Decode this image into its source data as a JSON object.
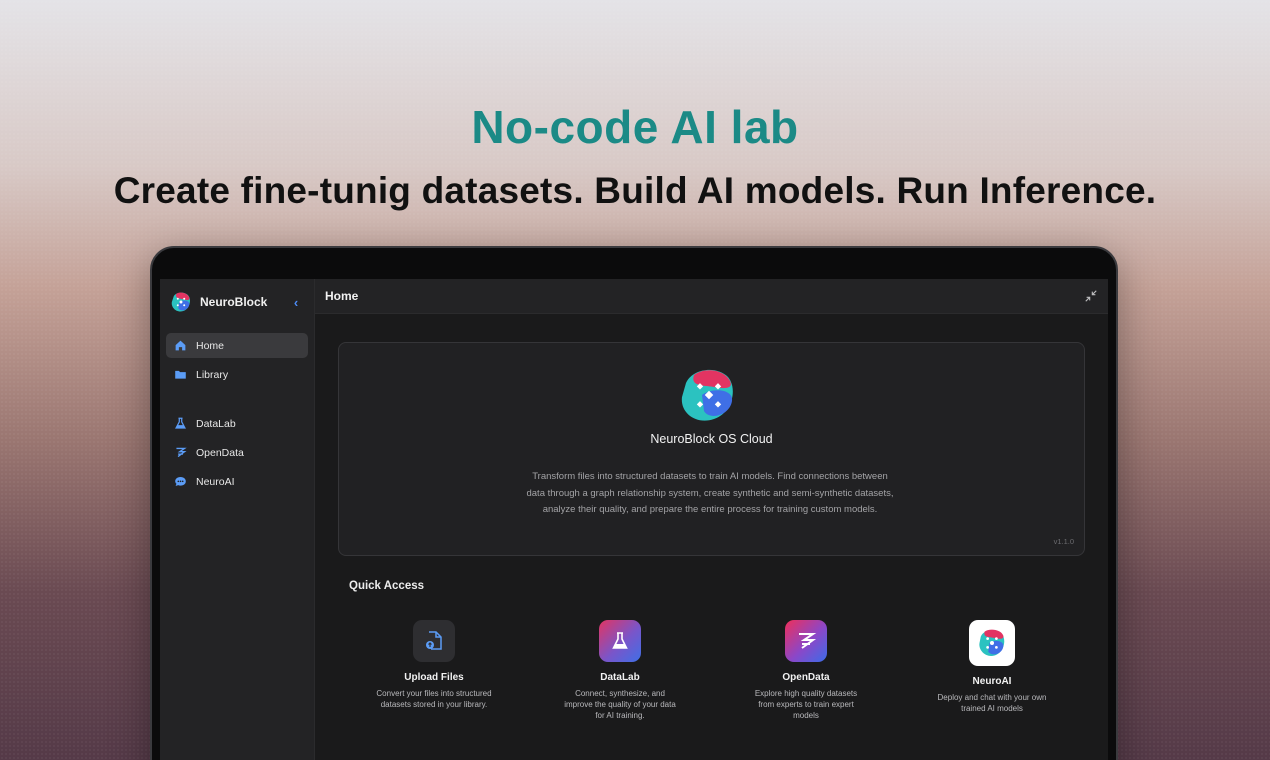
{
  "marketing": {
    "headline": "No-code AI lab",
    "subheadline": "Create fine-tunig datasets. Build AI models. Run Inference."
  },
  "sidebar": {
    "brand": "NeuroBlock",
    "items": [
      {
        "label": "Home",
        "icon": "home-icon",
        "active": true
      },
      {
        "label": "Library",
        "icon": "folder-icon",
        "active": false
      },
      {
        "label": "DataLab",
        "icon": "flask-icon",
        "active": false
      },
      {
        "label": "OpenData",
        "icon": "layers-icon",
        "active": false
      },
      {
        "label": "NeuroAI",
        "icon": "chat-bubble-icon",
        "active": false
      }
    ]
  },
  "topbar": {
    "title": "Home"
  },
  "hero": {
    "title": "NeuroBlock OS Cloud",
    "description": "Transform files into structured datasets to train AI models. Find connections between data through a graph relationship system, create synthetic and semi-synthetic datasets, analyze their quality, and prepare the entire process for training custom models.",
    "version": "v1.1.0"
  },
  "quick_access": {
    "title": "Quick Access",
    "cards": [
      {
        "name": "Upload Files",
        "description": "Convert your files into structured datasets stored in your library.",
        "icon": "file-upload-icon"
      },
      {
        "name": "DataLab",
        "description": "Connect, synthesize, and improve the quality of your data for AI training.",
        "icon": "flask-icon"
      },
      {
        "name": "OpenData",
        "description": "Explore high quality datasets from experts to train expert models",
        "icon": "layers-icon"
      },
      {
        "name": "NeuroAI",
        "description": "Deploy and chat with your own trained AI models",
        "icon": "neuroblock-logo-icon"
      }
    ]
  },
  "colors": {
    "headline": "#1b8a86",
    "accent": "#4d8bf5",
    "brand_red": "#e23462",
    "brand_blue": "#3f6fe6",
    "brand_teal": "#2bc2c0"
  }
}
